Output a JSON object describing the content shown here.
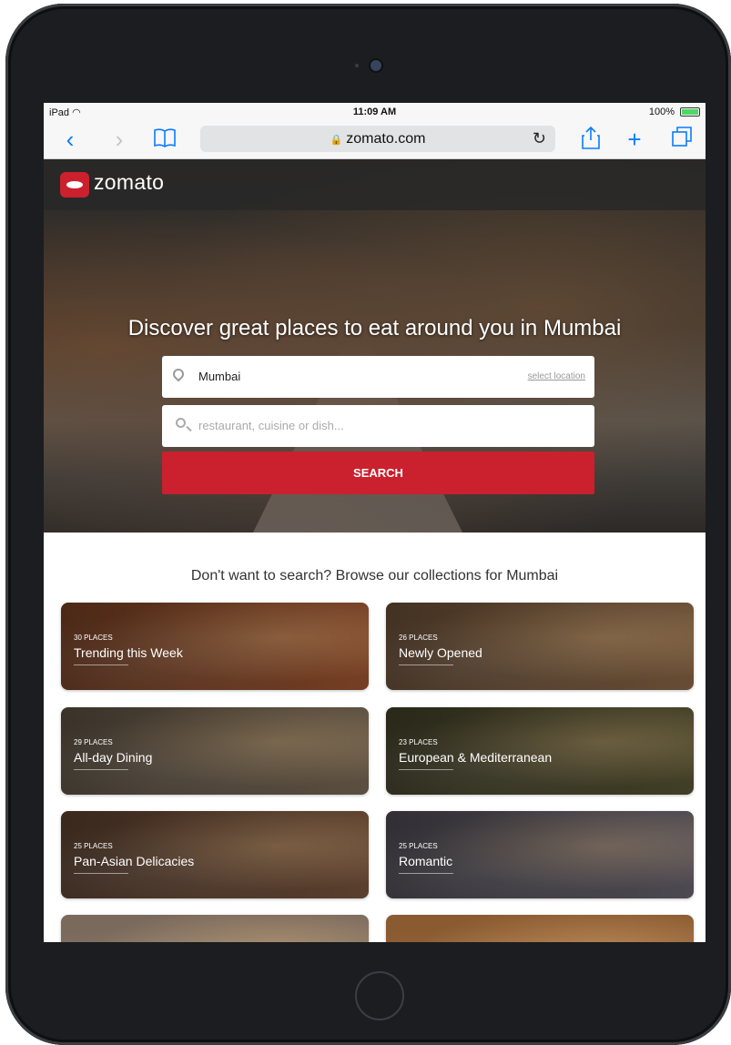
{
  "status_bar": {
    "carrier": "iPad",
    "time": "11:09 AM",
    "battery": "100%"
  },
  "browser": {
    "url": "zomato.com"
  },
  "site": {
    "logo_text": "zomato"
  },
  "hero": {
    "title": "Discover great places to eat around you in Mumbai",
    "location_value": "Mumbai",
    "select_location_label": "select location",
    "search_placeholder": "restaurant, cuisine or dish...",
    "search_button": "SEARCH"
  },
  "collections": {
    "heading": "Don't want to search? Browse our collections for Mumbai",
    "items": [
      {
        "count": "30 PLACES",
        "name": "Trending this Week",
        "color": "#8a4a2a"
      },
      {
        "count": "26 PLACES",
        "name": "Newly Opened",
        "color": "#7a5a3e"
      },
      {
        "count": "29 PLACES",
        "name": "All-day Dining",
        "color": "#6b5d4c"
      },
      {
        "count": "23 PLACES",
        "name": "European & Mediterranean",
        "color": "#4d4a2e"
      },
      {
        "count": "25 PLACES",
        "name": "Pan-Asian Delicacies",
        "color": "#6a4a36"
      },
      {
        "count": "25 PLACES",
        "name": "Romantic",
        "color": "#5a5660"
      },
      {
        "count": "",
        "name": "",
        "color": "#7a6a5c"
      },
      {
        "count": "",
        "name": "",
        "color": "#8a5a30"
      }
    ]
  }
}
